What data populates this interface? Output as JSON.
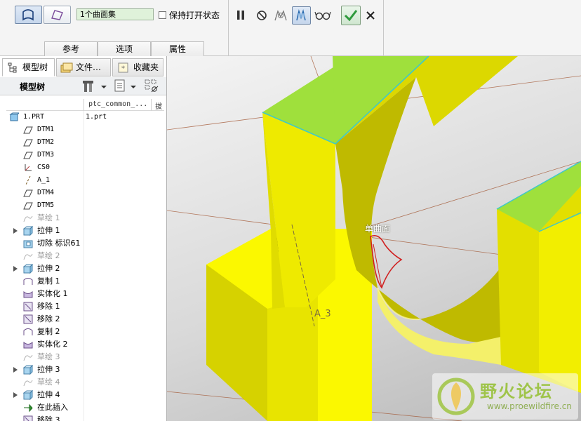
{
  "ribbon": {
    "collector_value": "1个曲面集",
    "keep_open_label": "保持打开状态",
    "keep_open_checked": false,
    "tabs": [
      "参考",
      "选项",
      "属性"
    ]
  },
  "panel": {
    "tabs": [
      "模型树",
      "文件…",
      "收藏夹"
    ],
    "tree_title": "模型树",
    "columns": [
      "ptc_common_...",
      "拔"
    ]
  },
  "tree": {
    "items": [
      {
        "label": "1.PRT",
        "col": "1.prt",
        "icon": "part-icon",
        "expand": false,
        "dim": false
      },
      {
        "label": "DTM1",
        "icon": "datum-plane-icon",
        "expand": false,
        "dim": false
      },
      {
        "label": "DTM2",
        "icon": "datum-plane-icon",
        "expand": false,
        "dim": false
      },
      {
        "label": "DTM3",
        "icon": "datum-plane-icon",
        "expand": false,
        "dim": false
      },
      {
        "label": "CS0",
        "icon": "coord-system-icon",
        "expand": false,
        "dim": false
      },
      {
        "label": "A_1",
        "icon": "datum-axis-icon",
        "expand": false,
        "dim": false
      },
      {
        "label": "DTM4",
        "icon": "datum-plane-icon",
        "expand": false,
        "dim": false
      },
      {
        "label": "DTM5",
        "icon": "datum-plane-icon",
        "expand": false,
        "dim": false
      },
      {
        "label": "草绘 1",
        "icon": "sketch-icon",
        "expand": false,
        "dim": true
      },
      {
        "label": "拉伸 1",
        "icon": "extrude-icon",
        "expand": true,
        "dim": false
      },
      {
        "label": "切除 标识61",
        "icon": "cut-icon",
        "expand": false,
        "dim": false
      },
      {
        "label": "草绘 2",
        "icon": "sketch-icon",
        "expand": false,
        "dim": true
      },
      {
        "label": "拉伸 2",
        "icon": "extrude-icon",
        "expand": true,
        "dim": false
      },
      {
        "label": "复制 1",
        "icon": "copy-icon",
        "expand": false,
        "dim": false
      },
      {
        "label": "实体化 1",
        "icon": "solidify-icon",
        "expand": false,
        "dim": false
      },
      {
        "label": "移除 1",
        "icon": "remove-icon",
        "expand": false,
        "dim": false
      },
      {
        "label": "移除 2",
        "icon": "remove-icon",
        "expand": false,
        "dim": false
      },
      {
        "label": "复制 2",
        "icon": "copy-icon",
        "expand": false,
        "dim": false
      },
      {
        "label": "实体化 2",
        "icon": "solidify-icon",
        "expand": false,
        "dim": false
      },
      {
        "label": "草绘 3",
        "icon": "sketch-icon",
        "expand": false,
        "dim": true
      },
      {
        "label": "拉伸 3",
        "icon": "extrude-icon",
        "expand": true,
        "dim": false
      },
      {
        "label": "草绘 4",
        "icon": "sketch-icon",
        "expand": false,
        "dim": true
      },
      {
        "label": "拉伸 4",
        "icon": "extrude-icon",
        "expand": true,
        "dim": false
      },
      {
        "label": "在此插入",
        "icon": "insert-here-icon",
        "expand": false,
        "dim": false
      },
      {
        "label": "移除 3",
        "icon": "remove-icon",
        "expand": false,
        "dim": false
      }
    ]
  },
  "viewport": {
    "surface_label": "单曲面",
    "axis_label": "A_3"
  },
  "watermark": {
    "title": "野火论坛",
    "url": "www.proewildfire.cn"
  },
  "colors": {
    "model_yellow": "#e6e000",
    "top_face_green": "#9fe03c",
    "edge_cyan": "#40c8c8",
    "datum_line": "#a0522d",
    "selection_red": "#d02020",
    "accept_green": "#2e9a3c"
  }
}
